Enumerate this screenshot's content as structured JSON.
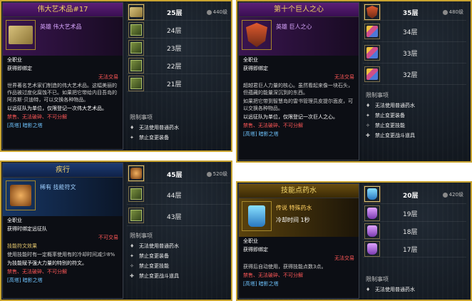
{
  "p1": {
    "title": "伟大艺术品#17",
    "type": "英雄 伟大艺术品",
    "job": "全职业",
    "bind": "获得即绑定",
    "no_trade": "无法交易",
    "desc": "世界著名艺术家们制造的伟大艺术品。这幅美丽的作品被过度化腐蚀不已。如果把它带给内目吾岛的阿苏斯·贝迪特，可以交换各种物品。",
    "note": "以远征队为单位，仅限登记一次伟大艺术品。",
    "rules": "禁售、无法破碎、不可分解",
    "source": "[高塔] 暗影之塔",
    "list": [
      {
        "level": "25层",
        "points": "440级"
      },
      {
        "level": "24层",
        "points": ""
      },
      {
        "level": "23层",
        "points": ""
      },
      {
        "level": "22层",
        "points": ""
      },
      {
        "level": "21层",
        "points": ""
      }
    ],
    "restr_title": "限制事项",
    "restr": [
      "无法使用普通药水",
      "禁止变更装备"
    ]
  },
  "p2": {
    "title": "第十个巨人之心",
    "type": "英雄 巨人之心",
    "job": "全职业",
    "bind": "获得即绑定",
    "no_trade": "无法交易",
    "desc": "超越君巨人力量的核心。虽然看起来像一块石头，但蕴藏的能量深沉到的东西。",
    "desc2": "如果把它带到智慧岛的雷书管理员皮提尔面皮，可以交换各种物品。",
    "note": "以远征队为单位，仅限登记一次巨人之心。",
    "rules": "禁售、无法破碎、不可分解",
    "source": "[高塔] 暗影之塔",
    "list": [
      {
        "level": "35层",
        "points": "480级"
      },
      {
        "level": "34层",
        "points": ""
      },
      {
        "level": "33层",
        "points": ""
      },
      {
        "level": "32层",
        "points": ""
      }
    ],
    "restr_title": "限制事项",
    "restr": [
      "无法使用普通药水",
      "禁止变更装备",
      "禁止变更技能",
      "禁止变更战斗道具"
    ]
  },
  "p3": {
    "title": "疾行",
    "type": "稀有 技能符文",
    "job": "全职业",
    "bind": "获得时绑定远征队",
    "no_trade": "不可交易",
    "effect_title": "技能符文效果",
    "effect": "使用技能时有一定概率使用有的冷却时间减少8%",
    "note": "为技能赋予强大力量的特别的符文。",
    "rules": "禁售、无法破碎、不可分解",
    "source": "[高塔] 暗影之塔",
    "list": [
      {
        "level": "45层",
        "points": "520级"
      },
      {
        "level": "44层",
        "points": ""
      },
      {
        "level": "43层",
        "points": ""
      }
    ],
    "restr_title": "限制事项",
    "restr": [
      "无法使用普通药水",
      "禁止变更装备",
      "禁止变更技能",
      "禁止变更战斗道具"
    ]
  },
  "p4": {
    "title": "技能点药水",
    "type": "传说 特殊药水",
    "cooldown": "冷却时间 1秒",
    "job": "全职业",
    "bind": "获得即绑定",
    "no_trade": "无法交易",
    "desc": "获得后自动使用，获得技能点数3点。",
    "rules": "禁售、无法破碎、不可分解",
    "source": "[高塔] 暗影之塔",
    "list": [
      {
        "level": "20层",
        "points": "420级"
      },
      {
        "level": "19层",
        "points": ""
      },
      {
        "level": "18层",
        "points": ""
      },
      {
        "level": "17层",
        "points": ""
      }
    ],
    "restr_title": "限制事项",
    "restr": [
      "无法使用普通药水"
    ]
  },
  "colors": {
    "border": "#c9a430",
    "red": "#ff5757",
    "cyan": "#6fc4ff"
  }
}
